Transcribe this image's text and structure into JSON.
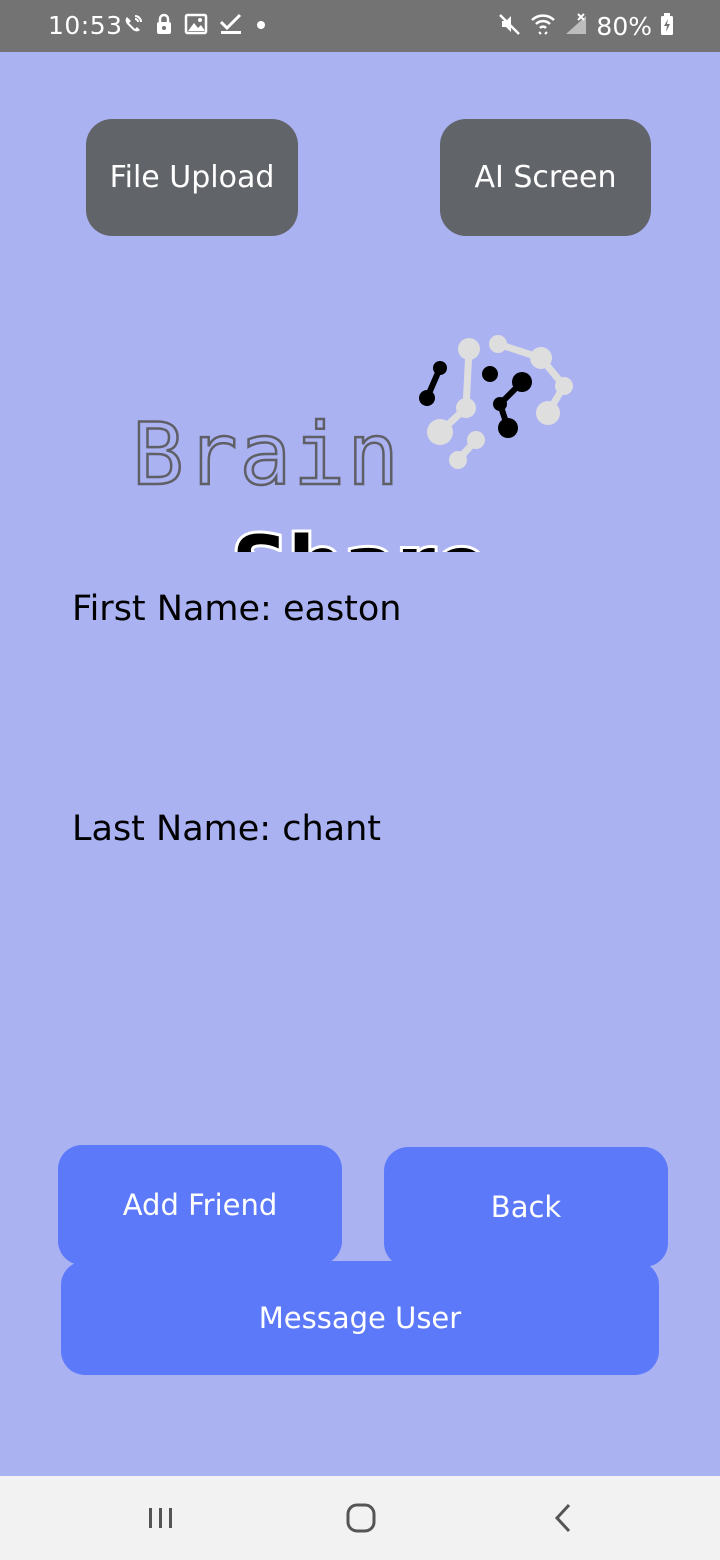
{
  "status_bar": {
    "time": "10:53",
    "battery": "80%",
    "icons_left": [
      "wifi-calling-icon",
      "lock-icon",
      "image-icon",
      "check-icon",
      "dot-icon"
    ],
    "icons_right": [
      "mute-icon",
      "wifi-icon",
      "signal-icon",
      "battery-icon"
    ]
  },
  "top_buttons": {
    "file_upload": "File Upload",
    "ai_screen": "AI Screen"
  },
  "logo": {
    "line1": "Brain",
    "line2": "Share"
  },
  "profile": {
    "first_name": "First Name: easton",
    "last_name": "Last Name: chant"
  },
  "actions": {
    "add_friend": "Add Friend",
    "back": "Back",
    "message_user": "Message User"
  },
  "nav": {
    "icons": [
      "recent-apps-icon",
      "home-icon",
      "back-icon"
    ]
  },
  "colors": {
    "background": "#aab2f2",
    "dark_button": "#616469",
    "blue_button": "#5c79fa",
    "status_bar": "#737373"
  }
}
